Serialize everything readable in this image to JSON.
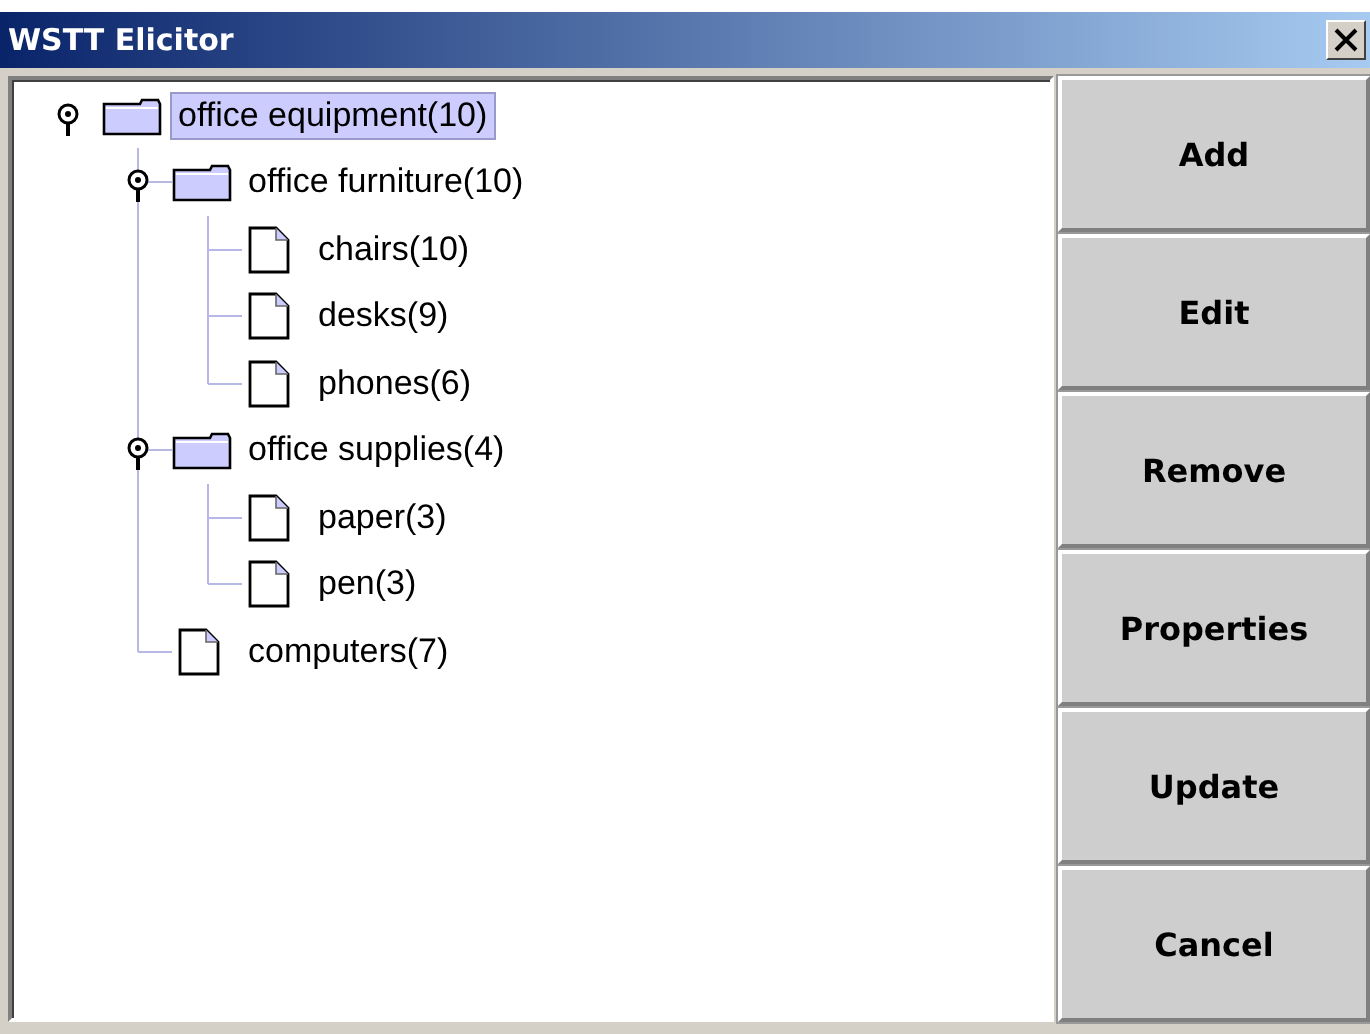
{
  "window": {
    "title": "WSTT Elicitor"
  },
  "tree": [
    {
      "label": "office equipment(10)",
      "kind": "folder",
      "expanded": true,
      "selected": true,
      "children": [
        {
          "label": "office furniture(10)",
          "kind": "folder",
          "expanded": true,
          "selected": false,
          "children": [
            {
              "label": "chairs(10)",
              "kind": "document",
              "selected": false
            },
            {
              "label": "desks(9)",
              "kind": "document",
              "selected": false
            },
            {
              "label": "phones(6)",
              "kind": "document",
              "selected": false
            }
          ]
        },
        {
          "label": "office supplies(4)",
          "kind": "folder",
          "expanded": true,
          "selected": false,
          "children": [
            {
              "label": "paper(3)",
              "kind": "document",
              "selected": false
            },
            {
              "label": "pen(3)",
              "kind": "document",
              "selected": false
            }
          ]
        },
        {
          "label": "computers(7)",
          "kind": "document",
          "selected": false
        }
      ]
    }
  ],
  "buttons": [
    "Add",
    "Edit",
    "Remove",
    "Properties",
    "Update",
    "Cancel"
  ]
}
